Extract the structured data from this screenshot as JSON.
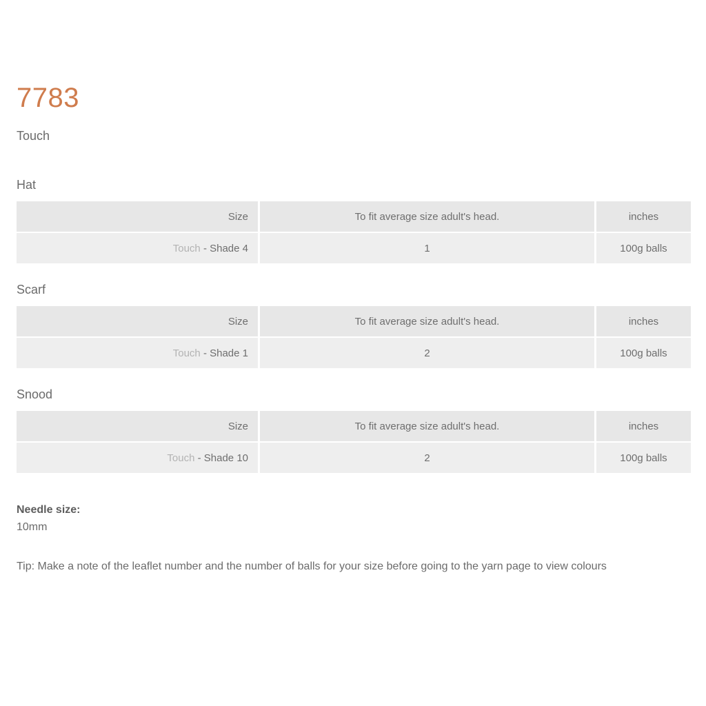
{
  "header": {
    "leaflet_number": "7783",
    "yarn_name": "Touch"
  },
  "sections": [
    {
      "title": "Hat",
      "header_row": {
        "label": "Size",
        "value": "To fit average size adult's head.",
        "unit": "inches"
      },
      "data_row": {
        "yarn_brand": "Touch",
        "yarn_shade": "- Shade 4",
        "value": "1",
        "unit": "100g balls"
      }
    },
    {
      "title": "Scarf",
      "header_row": {
        "label": "Size",
        "value": "To fit average size adult's head.",
        "unit": "inches"
      },
      "data_row": {
        "yarn_brand": "Touch",
        "yarn_shade": "- Shade 1",
        "value": "2",
        "unit": "100g balls"
      }
    },
    {
      "title": "Snood",
      "header_row": {
        "label": "Size",
        "value": "To fit average size adult's head.",
        "unit": "inches"
      },
      "data_row": {
        "yarn_brand": "Touch",
        "yarn_shade": "- Shade 10",
        "value": "2",
        "unit": "100g balls"
      }
    }
  ],
  "notes": {
    "needle_label": "Needle size:",
    "needle_value": "10mm",
    "tip": "Tip: Make a note of the leaflet number and the number of balls for your size before going to the yarn page to view colours"
  },
  "colors": {
    "accent": "#cf7c4d",
    "body_text": "#6b6b6b",
    "muted_text": "#b3b3b3",
    "header_row_bg": "#e7e7e7",
    "data_row_bg": "#eeeeee",
    "page_bg": "#ffffff"
  }
}
